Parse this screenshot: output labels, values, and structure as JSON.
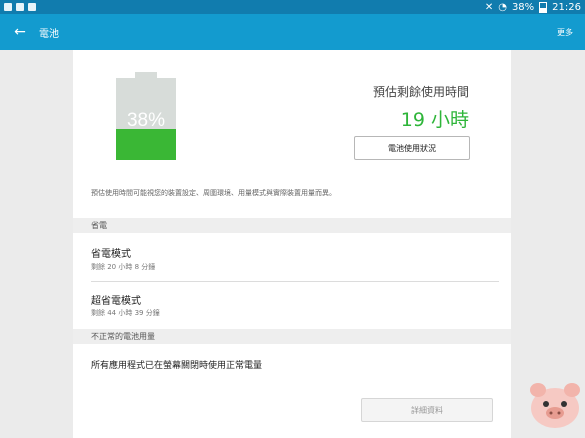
{
  "status_bar": {
    "battery_percent": "38%",
    "time": "21:26"
  },
  "app_bar": {
    "title": "電池",
    "more_label": "更多"
  },
  "battery": {
    "level": 0.38,
    "percent_label": "38%",
    "estimate_label": "預估剩餘使用時間",
    "estimate_value": "19 小時",
    "usage_button_label": "電池使用狀況",
    "note": "預估使用時間可能視您的裝置設定、周圍環境、用量模式與實際裝置用量而異。"
  },
  "power_saving": {
    "header": "省電",
    "items": [
      {
        "title": "省電模式",
        "subtitle": "剩餘 20 小時 8 分鐘"
      },
      {
        "title": "超省電模式",
        "subtitle": "剩餘 44 小時 39 分鐘"
      }
    ]
  },
  "abnormal_usage": {
    "header": "不正常的電池用量",
    "message": "所有應用程式已在螢幕關閉時使用正常電量",
    "detail_button_label": "詳細資料"
  },
  "colors": {
    "status_bar": "#117cae",
    "app_bar": "#139bcf",
    "battery_fill": "#3ab735",
    "estimate_text": "#2eb539"
  }
}
